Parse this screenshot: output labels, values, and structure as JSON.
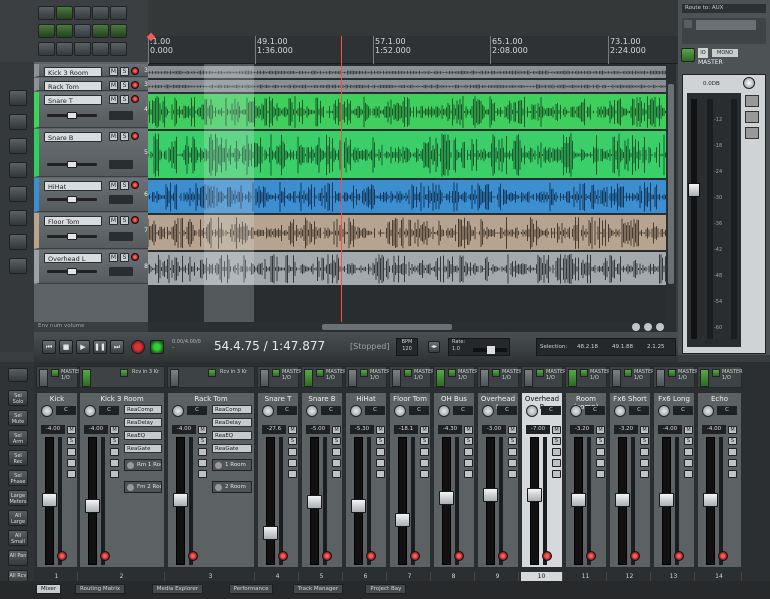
{
  "ruler": {
    "marks": [
      {
        "bar": ".1.00",
        "time": "0.000"
      },
      {
        "bar": "49.1.00",
        "time": "1:36.000"
      },
      {
        "bar": "57.1.00",
        "time": "1:52.000"
      },
      {
        "bar": "65.1.00",
        "time": "2:08.000"
      },
      {
        "bar": "73.1.00",
        "time": "2:24.000"
      }
    ]
  },
  "tracks": [
    {
      "name": "Kick 3 Room",
      "num": "3",
      "color": "#8c9396",
      "lane": "#8a9093",
      "wave": "#3a3f42"
    },
    {
      "name": "Rack Tom",
      "num": "3",
      "color": "#8c9396",
      "lane": "#8a9093",
      "wave": "#3a3f42"
    },
    {
      "name": "Snare T",
      "num": "4",
      "color": "#39d65a",
      "lane": "#3ecf5c",
      "wave": "#1b5a2a"
    },
    {
      "name": "Snare B",
      "num": "5",
      "color": "#2fcf5f",
      "lane": "#3bcf6a",
      "wave": "#175a2c"
    },
    {
      "name": "HiHat",
      "num": "6",
      "color": "#3a8fd1",
      "lane": "#3b8ed0",
      "wave": "#12385c"
    },
    {
      "name": "Floor Tom",
      "num": "7",
      "color": "#b8a58e",
      "lane": "#b6a490",
      "wave": "#4a3d2f"
    },
    {
      "name": "Overhead L",
      "num": "8",
      "color": "#9aa2a6",
      "lane": "#a3aaae",
      "wave": "#34393c"
    }
  ],
  "tcp_footer": "Env num volume",
  "transport": {
    "position": "54.4.75 / 1:47.877",
    "state": "[Stopped]",
    "bpm": "BPM\n120",
    "rate": "Rate:\n1.0",
    "selection_label": "Selection:",
    "sel_start": "48.2.18",
    "sel_end": "49.1.88",
    "sel_len": "2.1.25",
    "clock_label": "0.00/4.00/0",
    "clock_sub": "–"
  },
  "master": {
    "title": "MASTER",
    "label": "0.0DB",
    "fx_label": "Route to: AUX",
    "scale": [
      "-12",
      "-18",
      "-24",
      "-30",
      "-36",
      "-42",
      "-48",
      "-54",
      "-60"
    ],
    "readout": "-60.0"
  },
  "mixer_left": [
    "Sel Solo",
    "Sel Mute",
    "Sel Arm",
    "Sel Rec",
    "Sel Phase",
    "Large Meters",
    "All Large",
    "All Small",
    "All Pan",
    "All Rcv"
  ],
  "strips": [
    {
      "name": "Kick",
      "num": "1",
      "io": "MASTER\n1/O",
      "pan": "C",
      "vol": "-4.00",
      "knob": 0.5
    },
    {
      "name": "Kick 3 Room",
      "num": "2",
      "io": "Rcv in 3 Kr",
      "pan": "C",
      "vol": "-4.00",
      "knob": 0.55,
      "fx": [
        "ReaComp",
        "ReaDelay",
        "ReaEQ",
        "ReaGate"
      ],
      "sends": [
        "Rm 1 Room",
        "Fm 2 Room"
      ]
    },
    {
      "name": "Rack Tom",
      "num": "3",
      "io": "Rcv in 3 Kr",
      "pan": "C",
      "vol": "-4.00",
      "knob": 0.5,
      "fx": [
        "ReaComp",
        "ReaDelay",
        "ReaEQ",
        "ReaGate"
      ],
      "sends": [
        "1 Room",
        "2 Room"
      ]
    },
    {
      "name": "Snare T",
      "num": "4",
      "io": "MASTER\n1/O",
      "pan": "C",
      "vol": "-27.6",
      "knob": 0.8
    },
    {
      "name": "Snare B",
      "num": "5",
      "io": "MASTER\n1/O",
      "pan": "C",
      "vol": "-5.00",
      "knob": 0.52
    },
    {
      "name": "HiHat",
      "num": "6",
      "io": "MASTER\n1/O",
      "pan": "C",
      "vol": "-5.30",
      "knob": 0.55
    },
    {
      "name": "Floor Tom",
      "num": "7",
      "io": "MASTER\n1/O",
      "pan": "C",
      "vol": "-18.1",
      "knob": 0.68
    },
    {
      "name": "OH Bus",
      "num": "8",
      "io": "MASTER\n1/O",
      "pan": "C",
      "vol": "-4.30",
      "knob": 0.48
    },
    {
      "name": "Overhead L",
      "num": "9",
      "io": "MASTER\n1/O",
      "pan": "C",
      "vol": "-3.00",
      "knob": 0.45
    },
    {
      "name": "Overhead R",
      "num": "10",
      "io": "MASTER\n1/O",
      "pan": "C",
      "vol": "-7.00",
      "knob": 0.45,
      "selected": true
    },
    {
      "name": "Room (comp)",
      "num": "11",
      "io": "MASTER\n1/O",
      "pan": "C",
      "vol": "-3.20",
      "knob": 0.5
    },
    {
      "name": "Fx6 Short",
      "num": "12",
      "io": "MASTER\n1/O",
      "pan": "C",
      "vol": "-3.20",
      "knob": 0.5
    },
    {
      "name": "Fx6 Long",
      "num": "13",
      "io": "MASTER\n1/O",
      "pan": "C",
      "vol": "-4.00",
      "knob": 0.5
    },
    {
      "name": "Echo",
      "num": "14",
      "io": "MASTER\n1/O",
      "pan": "C",
      "vol": "-4.00",
      "knob": 0.5
    }
  ],
  "tabs": [
    "Mixer",
    "Routing Matrix",
    "Media Explorer",
    "Performance",
    "Track Manager",
    "Project Bay"
  ],
  "colors": {
    "accent": "#3ecf5c",
    "record": "#e03a3a",
    "cursor": "#ff4a4a"
  }
}
